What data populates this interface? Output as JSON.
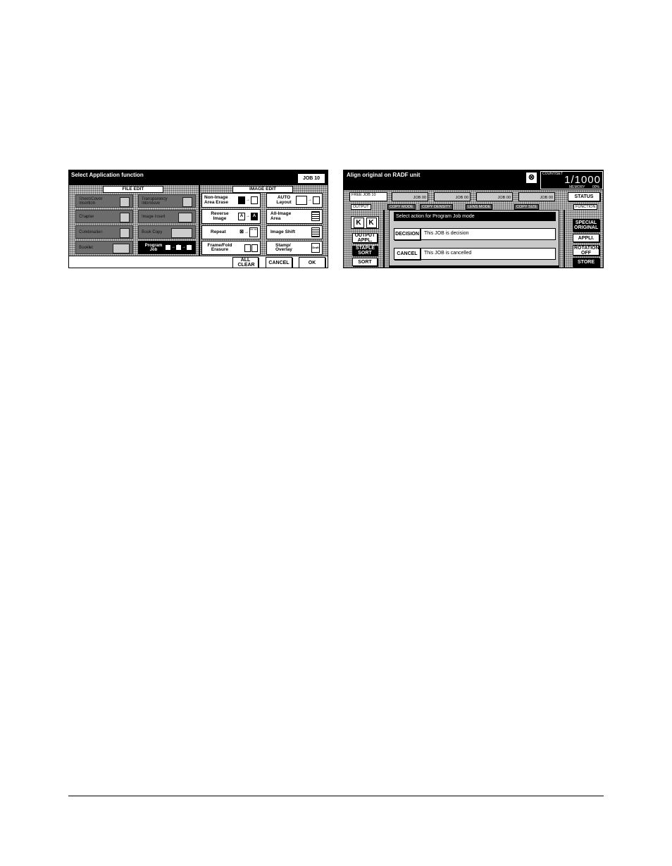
{
  "left_screen": {
    "title": "Select Application function",
    "job_label": "JOB 10",
    "file_edit_header": "FILE EDIT",
    "image_edit_header": "IMAGE EDIT",
    "file_edit_buttons": [
      "Sheet/Cover Insertion",
      "Transparency Interleave",
      "Chapter",
      "Image Insert",
      "Combination",
      "Book Copy",
      "Booklet",
      "Program Job"
    ],
    "image_edit_buttons": [
      "Non-Image Area Erase",
      "AUTO Layout",
      "Reverse Image",
      "All-Image Area",
      "Repeat",
      "Image Shift",
      "Frame/Fold Erasure",
      "Stamp/ Overlay"
    ],
    "bottom_buttons": [
      "ALL CLEAR",
      "CANCEL",
      "OK"
    ]
  },
  "right_screen": {
    "title": "Align original on RADF unit",
    "counter_label": "COUNT/SET",
    "counter_value": "1/1000",
    "memory_label": "MEMORY",
    "memory_value": "00%",
    "job_tabs": [
      "FREE JOB 10",
      "JOB 00",
      "JOB 00",
      "JOB 00",
      "JOB 00"
    ],
    "status_button": "STATUS",
    "tabs": [
      "OUTPUT",
      "COPY MODE",
      "COPY DENSITY",
      "LENS MODE",
      "COPY SIZE",
      "FUNCTION"
    ],
    "output_buttons": [
      "OUTPUT APPL.",
      "STAPLE SORT",
      "SORT"
    ],
    "dialog_title": "Select action for Program Job mode",
    "decision_button": "DECISION",
    "decision_text": "This JOB is decision",
    "cancel_button": "CANCEL",
    "cancel_text": "This JOB is cancelled",
    "function_buttons": [
      "SPECIAL ORIGINAL",
      "APPLI.",
      "ROTATION OFF",
      "STORE"
    ]
  }
}
